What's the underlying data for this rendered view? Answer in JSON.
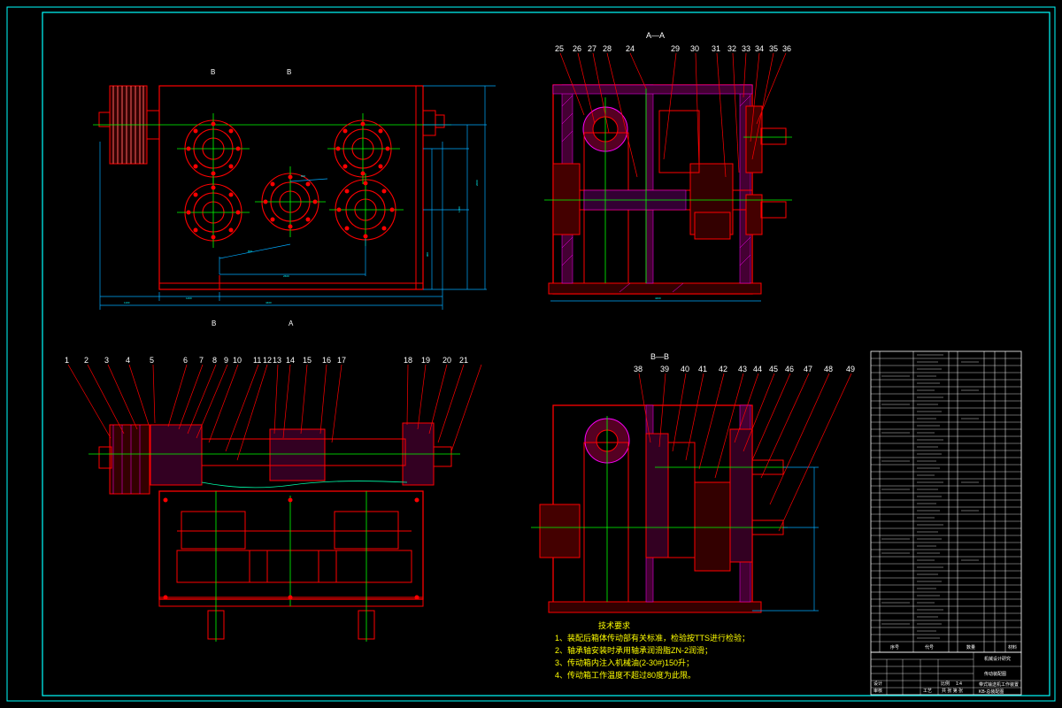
{
  "section_labels": {
    "aa": "A—A",
    "bb": "B—B"
  },
  "view_marks": {
    "top_left_1": "B",
    "top_left_2": "B",
    "bottom_left_1": "B",
    "bottom_left_2": "A"
  },
  "balloons_section_aa": [
    "25",
    "26",
    "27",
    "28",
    "24",
    "29",
    "30",
    "31",
    "32",
    "33",
    "34",
    "35",
    "36"
  ],
  "balloons_main_view": [
    "1",
    "2",
    "3",
    "4",
    "5",
    "6",
    "7",
    "8",
    "9",
    "10",
    "11",
    "12",
    "13",
    "14",
    "15",
    "16",
    "17",
    "18",
    "19",
    "20",
    "21"
  ],
  "balloons_section_bb": [
    "38",
    "39",
    "40",
    "41",
    "42",
    "43",
    "44",
    "45",
    "46",
    "47",
    "48",
    "49"
  ],
  "notes": {
    "title": "技术要求",
    "items": [
      "1、装配后箱体传动部有关标准，检验按TTS进行检验；",
      "2、轴承轴安装时承用轴承润滑脂ZN-2润滑；",
      "3、传动箱内注入机械油(2-30#)150升；",
      "4、传动箱工作温度不超过80度为此限。"
    ]
  },
  "title_block": {
    "company": "机械设计研究",
    "drawing_name": "传动装配图",
    "project": "带式输送机工作装置",
    "drawing_no": "KB-总装配图",
    "scale_label": "比例",
    "scale_value": "1:4",
    "sheet": "共 张 第 张",
    "header_no": "序号",
    "header_code": "代号",
    "header_name": "名称",
    "header_qty": "数量",
    "header_material": "材料",
    "header_weight": "重量",
    "header_remark": "备注",
    "designer": "设计",
    "checker": "审核",
    "approver": "批准",
    "process": "工艺"
  },
  "colors": {
    "frame": "#00ffff",
    "outline": "#ff0000",
    "centerline": "#00ff00",
    "dimension": "#00aaff",
    "hatch": "#ff00ff",
    "label": "#ffffff",
    "note": "#ffff00"
  }
}
